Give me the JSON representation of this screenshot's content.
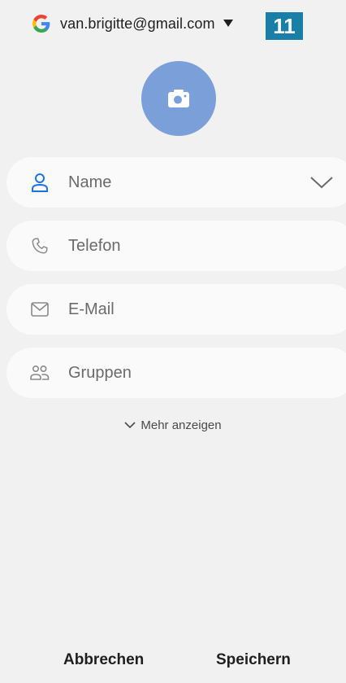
{
  "account": {
    "email": "van.brigitte@gmail.com",
    "provider_icon": "google-g-icon",
    "badge": "11"
  },
  "avatar": {
    "icon": "camera-icon",
    "color": "#7b9fd8"
  },
  "fields": {
    "name": {
      "placeholder": "Name",
      "icon": "person-icon",
      "expand_icon": "chevron-down-icon"
    },
    "phone": {
      "placeholder": "Telefon",
      "icon": "phone-icon"
    },
    "email": {
      "placeholder": "E-Mail",
      "icon": "mail-icon"
    },
    "groups": {
      "placeholder": "Gruppen",
      "icon": "groups-icon"
    }
  },
  "more": {
    "label": "Mehr anzeigen",
    "icon": "chevron-down-icon"
  },
  "actions": {
    "cancel": "Abbrechen",
    "save": "Speichern"
  },
  "colors": {
    "accent_blue": "#1a73e8",
    "badge_bg": "#1a7fa8",
    "background": "#f1f1f1",
    "field_bg": "#fafafa"
  }
}
